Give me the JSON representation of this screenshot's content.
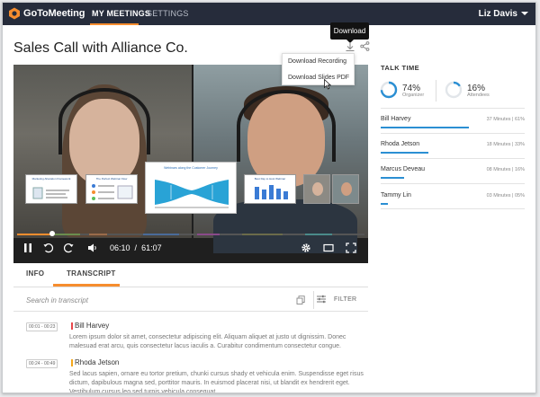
{
  "app": {
    "logo_text": "GoToMeeting",
    "nav": [
      {
        "label": "MY MEETINGS",
        "active": true
      },
      {
        "label": "SETTINGS",
        "active": false
      }
    ],
    "user_name": "Liz Davis",
    "accent_color": "#f68d2e",
    "nav_bg_color": "#262c3b"
  },
  "page": {
    "title": "Sales Call with Alliance Co.",
    "tooltip": "Download",
    "download_menu": [
      "Download Recording",
      "Download Slides PDF"
    ]
  },
  "player": {
    "current_time": "06:10",
    "separator": "/",
    "duration": "61:07",
    "progress_fraction": 0.101,
    "icons": [
      "play-pause-icon",
      "rewind-icon",
      "forward-icon",
      "volume-icon",
      "settings-icon",
      "theater-icon",
      "fullscreen-icon"
    ],
    "thumbnails": [
      {
        "title": "Marketing Allocation Framework"
      },
      {
        "title": "The Perfect Webinar Flow"
      },
      {
        "title": "Webinars along the Customer Journey"
      },
      {
        "title": "Best Day to Host Webinar"
      }
    ]
  },
  "tabs": [
    {
      "label": "INFO",
      "active": false
    },
    {
      "label": "TRANSCRIPT",
      "active": true
    }
  ],
  "search": {
    "placeholder": "Search in transcript",
    "filter_label": "FILTER"
  },
  "transcript": [
    {
      "time": "00:01 - 00:23",
      "speaker": "Bill Harvey",
      "color": "#e8474b",
      "text": "Lorem ipsum dolor sit amet, consectetur adipiscing elit. Aliquam aliquet at justo ut dignissim. Donec malesuad erat arcu, quis consectetur lacus iaculis a. Curabitur condimentum consectetur congue."
    },
    {
      "time": "00:24 - 00:49",
      "speaker": "Rhoda Jetson",
      "color": "#f4a81d",
      "text": "Sed lacus sapien, ornare eu tortor pretium, chunki cursus shady et vehicula enim. Suspendisse eget risus dictum, dapibulous magna sed, porttitor mauris. In euismod placerat nisi, ut blandit ex hendrerit eget. Vestibulum cursus leo sed turpis vehicula consequat."
    }
  ],
  "talk_time": {
    "title": "TALK TIME",
    "organizer": {
      "value": "74%",
      "fraction": 0.74,
      "label": "Organizer"
    },
    "attendees": {
      "value": "16%",
      "fraction": 0.16,
      "label": "Attendees"
    },
    "ring_color": "#2b8fd3",
    "people": [
      {
        "name": "Bill Harvey",
        "stat": "37 Minutes | 61%",
        "fraction": 0.61
      },
      {
        "name": "Rhoda Jetson",
        "stat": "18 Minutes | 33%",
        "fraction": 0.33
      },
      {
        "name": "Marcus Deveau",
        "stat": "08 Minutes | 16%",
        "fraction": 0.16
      },
      {
        "name": "Tammy Lin",
        "stat": "03 Minutes | 05%",
        "fraction": 0.05
      }
    ]
  }
}
